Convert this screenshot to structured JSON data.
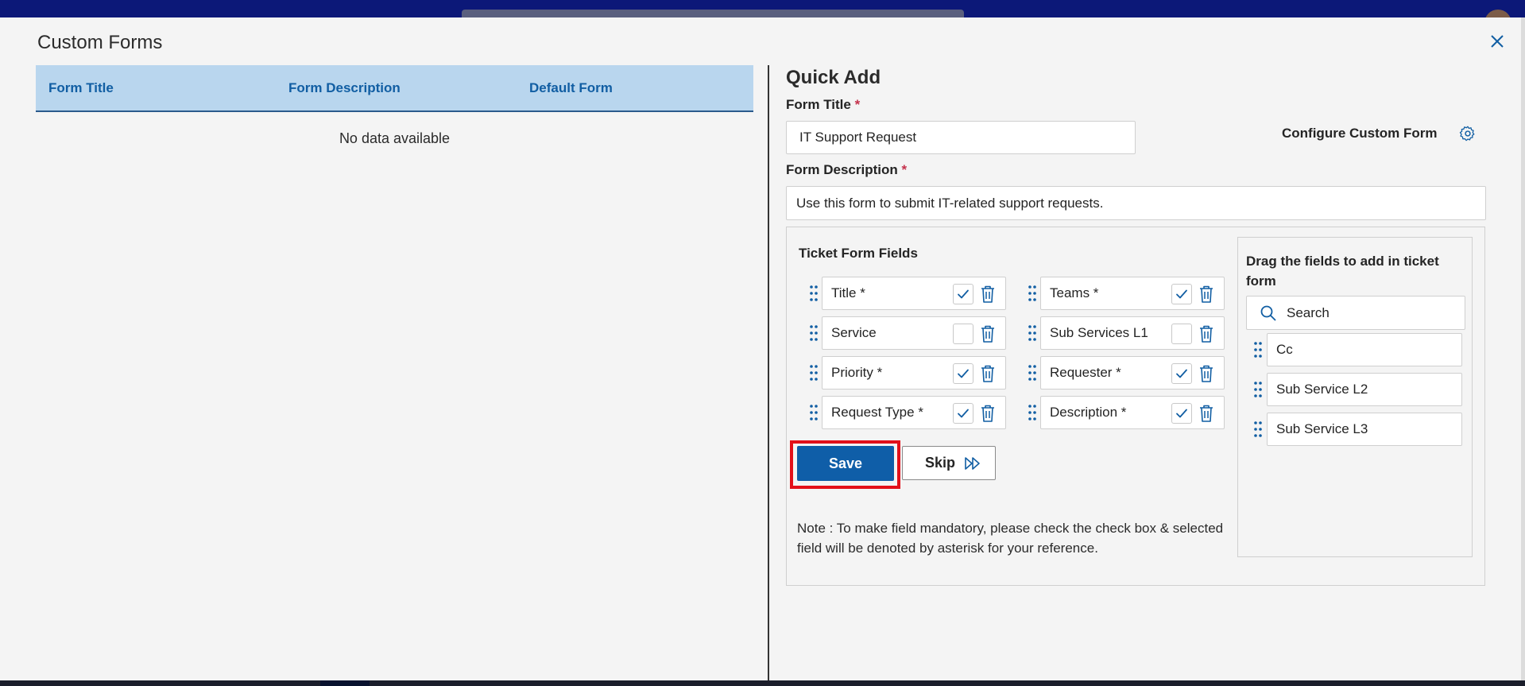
{
  "modal": {
    "title": "Custom Forms"
  },
  "grid": {
    "columns": [
      "Form Title",
      "Form Description",
      "Default Form"
    ],
    "empty_text": "No data available"
  },
  "quick_add": {
    "heading": "Quick Add",
    "form_title_label": "Form Title",
    "form_title_value": "IT Support Request",
    "form_description_label": "Form Description",
    "form_description_value": "Use this form to submit IT-related support requests.",
    "required_mark": "*",
    "configure_label": "Configure Custom Form"
  },
  "ticket_fields": {
    "title": "Ticket Form Fields",
    "items": [
      {
        "label": "Title *",
        "checked": true
      },
      {
        "label": "Teams *",
        "checked": true
      },
      {
        "label": "Service",
        "checked": false
      },
      {
        "label": "Sub Services L1",
        "checked": false
      },
      {
        "label": "Priority *",
        "checked": true
      },
      {
        "label": "Requester *",
        "checked": true
      },
      {
        "label": "Request Type *",
        "checked": true
      },
      {
        "label": "Description *",
        "checked": true
      }
    ]
  },
  "actions": {
    "save_label": "Save",
    "skip_label": "Skip"
  },
  "note": "Note : To make field mandatory, please check the check box & selected field will be denoted by asterisk for your reference.",
  "available_fields": {
    "title": "Drag the fields to add in ticket form",
    "search_placeholder": "Search",
    "items": [
      "Cc",
      "Sub Service L2",
      "Sub Service L3"
    ]
  },
  "colors": {
    "accent": "#0f5ea8",
    "header_bg": "#b9d6ee",
    "highlight": "#e3101a",
    "required": "#c4314b"
  },
  "icons": [
    "close-icon",
    "gear-icon",
    "drag-handle-icon",
    "check-icon",
    "trash-icon",
    "fast-forward-icon",
    "search-icon"
  ]
}
